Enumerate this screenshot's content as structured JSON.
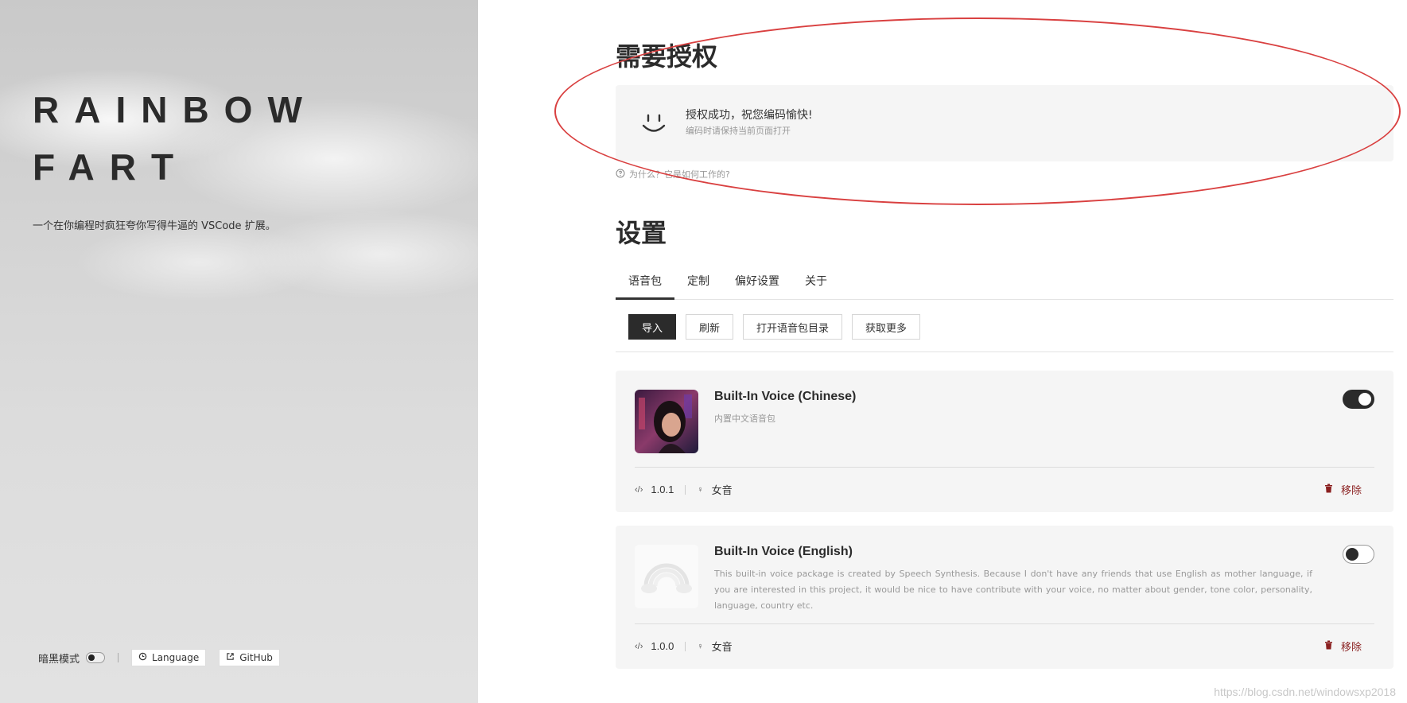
{
  "left": {
    "brand_line1": "RAINBOW",
    "brand_line2": "FART",
    "tagline": "一个在你编程时疯狂夸你写得牛逼的 VSCode 扩展。",
    "dark_mode_label": "暗黑模式",
    "dark_mode_on": false,
    "language_label": "Language",
    "github_label": "GitHub"
  },
  "auth": {
    "title": "需要授权",
    "message": "授权成功，祝您编码愉快!",
    "sub": "编码时请保持当前页面打开",
    "why_link": "为什么？它是如何工作的?"
  },
  "settings": {
    "title": "设置",
    "tabs": [
      {
        "label": "语音包",
        "active": true
      },
      {
        "label": "定制",
        "active": false
      },
      {
        "label": "偏好设置",
        "active": false
      },
      {
        "label": "关于",
        "active": false
      }
    ],
    "toolbar": {
      "import": "导入",
      "refresh": "刷新",
      "open_dir": "打开语音包目录",
      "get_more": "获取更多"
    }
  },
  "voices": [
    {
      "name": "Built-In Voice (Chinese)",
      "description": "内置中文语音包",
      "version": "1.0.1",
      "gender": "女音",
      "enabled": true,
      "remove_label": "移除"
    },
    {
      "name": "Built-In Voice (English)",
      "description": "This built-in voice package is created by Speech Synthesis. Because I don't have any friends that use English as mother language, if you are interested in this project, it would be nice to have contribute with your voice, no matter about gender, tone color, personality, language, country etc.",
      "version": "1.0.0",
      "gender": "女音",
      "enabled": false,
      "remove_label": "移除"
    }
  ],
  "watermark": "https://blog.csdn.net/windowsxp2018",
  "colors": {
    "accent": "#2b2b2b",
    "remove": "#8a1f1f",
    "highlight_circle": "#d94040",
    "card_bg": "#f5f5f5"
  }
}
